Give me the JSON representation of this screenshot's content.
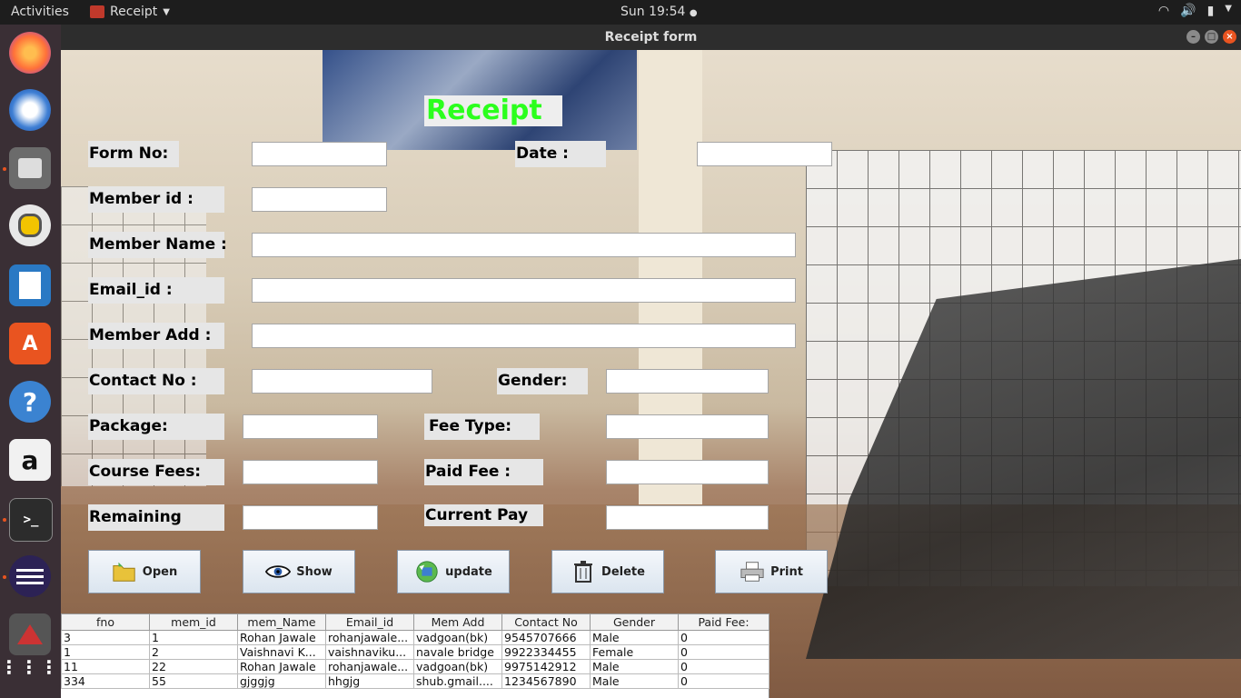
{
  "system": {
    "activities": "Activities",
    "app_name": "Receipt",
    "clock": "Sun 19:54"
  },
  "window": {
    "title": "Receipt form"
  },
  "form": {
    "heading": "Receipt",
    "labels": {
      "form_no": "Form No:",
      "date": "Date :",
      "member_id": "Member id :",
      "member_name": "Member Name :",
      "email_id": "Email_id :",
      "member_add": "Member Add :",
      "contact_no": "Contact No :",
      "gender": "Gender:",
      "package": "Package:",
      "fee_type": "Fee Type:",
      "course_fees": "Course Fees:",
      "paid_fee": "Paid Fee :",
      "remaining": "Remaining",
      "current_pay": "Current Pay"
    },
    "values": {
      "form_no": "",
      "date": "",
      "member_id": "",
      "member_name": "",
      "email_id": "",
      "member_add": "",
      "contact_no": "",
      "gender": "",
      "package": "",
      "fee_type": "",
      "course_fees": "",
      "paid_fee": "",
      "remaining": "",
      "current_pay": ""
    }
  },
  "buttons": {
    "open": "Open",
    "show": "Show",
    "update": "update",
    "delete": "Delete",
    "print": "Print"
  },
  "table": {
    "columns": [
      "fno",
      "mem_id",
      "mem_Name",
      "Email_id",
      "Mem Add",
      "Contact No",
      "Gender",
      "Paid Fee:"
    ],
    "rows": [
      [
        "3",
        "1",
        "Rohan Jawale",
        "rohanjawale...",
        "vadgoan(bk)",
        "9545707666",
        "Male",
        "0"
      ],
      [
        "1",
        "2",
        "Vaishnavi K...",
        "vaishnaviku...",
        "navale bridge",
        "9922334455",
        "Female",
        "0"
      ],
      [
        "11",
        "22",
        "Rohan Jawale",
        "rohanjawale...",
        "vadgoan(bk)",
        "9975142912",
        "Male",
        "0"
      ],
      [
        "334",
        "55",
        "gjggjg",
        "hhgjg",
        "shub.gmail....",
        "1234567890",
        "Male",
        "0"
      ]
    ]
  },
  "icons": {
    "dock": [
      "firefox-icon",
      "thunderbird-icon",
      "files-icon",
      "rhythmbox-icon",
      "writer-icon",
      "software-icon",
      "help-icon",
      "amazon-icon",
      "terminal-icon",
      "eclipse-icon",
      "java-icon",
      "apps-grid-icon"
    ],
    "buttons": [
      "folder-icon",
      "eye-icon",
      "refresh-icon",
      "trash-icon",
      "printer-icon"
    ]
  },
  "colors": {
    "heading": "#2bff1d",
    "topbar": "#1d1d1d",
    "dock": "#3a2f35"
  }
}
